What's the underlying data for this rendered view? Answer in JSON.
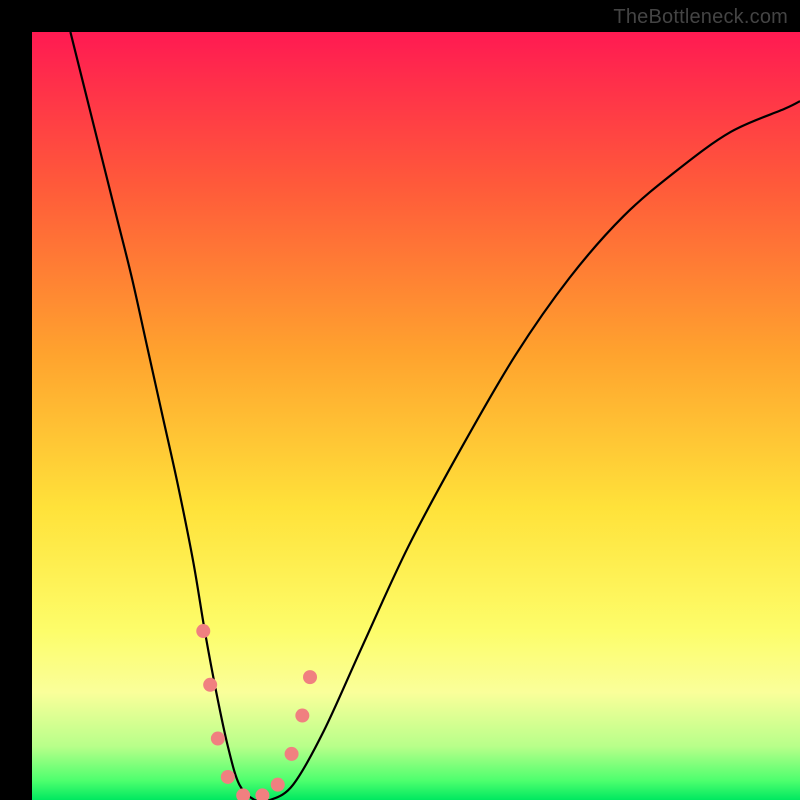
{
  "watermark": "TheBottleneck.com",
  "chart_data": {
    "type": "line",
    "title": "",
    "xlabel": "",
    "ylabel": "",
    "xlim": [
      0,
      100
    ],
    "ylim": [
      0,
      100
    ],
    "grid": false,
    "legend": false,
    "background_gradient": {
      "stops": [
        {
          "offset": 0.0,
          "color": "#ff1a52"
        },
        {
          "offset": 0.2,
          "color": "#ff5a3a"
        },
        {
          "offset": 0.42,
          "color": "#ffa32e"
        },
        {
          "offset": 0.62,
          "color": "#ffe23a"
        },
        {
          "offset": 0.78,
          "color": "#fdfd6a"
        },
        {
          "offset": 0.86,
          "color": "#faff9a"
        },
        {
          "offset": 0.93,
          "color": "#b8ff8a"
        },
        {
          "offset": 0.975,
          "color": "#4dff6e"
        },
        {
          "offset": 1.0,
          "color": "#00e860"
        }
      ]
    },
    "series": [
      {
        "name": "curve",
        "color": "#000000",
        "x": [
          5,
          7,
          9,
          11,
          13,
          15,
          17,
          19,
          21,
          22.5,
          24,
          25.5,
          27,
          29,
          31,
          34,
          38,
          43,
          49,
          56,
          63,
          70,
          77,
          84,
          91,
          98,
          100
        ],
        "y": [
          100,
          92,
          84,
          76,
          68,
          59,
          50,
          41,
          31,
          22,
          14,
          7,
          2,
          0,
          0,
          2,
          9,
          20,
          33,
          46,
          58,
          68,
          76,
          82,
          87,
          90,
          91
        ]
      }
    ],
    "markers": {
      "name": "highlight-dots",
      "color": "#f08080",
      "radius": 7,
      "points": [
        {
          "x": 22.3,
          "y": 22
        },
        {
          "x": 23.2,
          "y": 15
        },
        {
          "x": 24.2,
          "y": 8
        },
        {
          "x": 25.5,
          "y": 3
        },
        {
          "x": 27.5,
          "y": 0.6
        },
        {
          "x": 30.0,
          "y": 0.6
        },
        {
          "x": 32.0,
          "y": 2
        },
        {
          "x": 33.8,
          "y": 6
        },
        {
          "x": 35.2,
          "y": 11
        },
        {
          "x": 36.2,
          "y": 16
        }
      ]
    }
  }
}
